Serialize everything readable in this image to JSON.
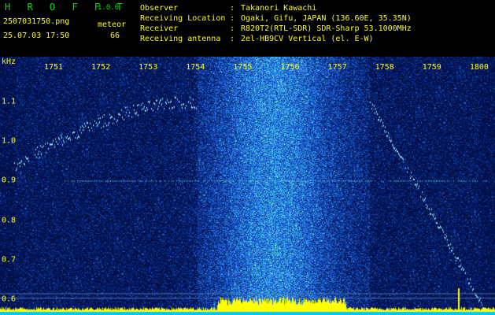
{
  "app": {
    "logo": "H R O F F T",
    "version": "1.0.0"
  },
  "capture": {
    "filename": "2507031750.png",
    "datetime": "25.07.03 17:50",
    "meteor_label": "meteor",
    "meteor_count": "66"
  },
  "info": [
    {
      "key": "Observer",
      "value": "Takanori Kawachi"
    },
    {
      "key": "Receiving Location",
      "value": "Ogaki, Gifu, JAPAN (136.60E, 35.35N)"
    },
    {
      "key": "Receiver",
      "value": "R820T2(RTL-SDR) SDR-Sharp 53.1000MHz"
    },
    {
      "key": "Receiving antenna",
      "value": "2el-HB9CV Vertical (el. E-W)"
    }
  ],
  "separator": ":",
  "chart_data": {
    "type": "heatmap",
    "ylabel": "kHz",
    "x_ticks": [
      "1751",
      "1752",
      "1753",
      "1754",
      "1755",
      "1756",
      "1757",
      "1758",
      "1759",
      "1800"
    ],
    "y_ticks": [
      "1.1",
      "1.0",
      "0.9",
      "0.8",
      "0.7",
      "0.6"
    ],
    "ylim": [
      0.58,
      1.18
    ],
    "beacon_line_khz": 0.9,
    "colors": {
      "background": "#06205e",
      "mid": "#2e74d8",
      "hot": "#45e6d0",
      "text": "#ffff00",
      "signal_bar": "#ffff00",
      "floor": "#00c8ff"
    }
  }
}
